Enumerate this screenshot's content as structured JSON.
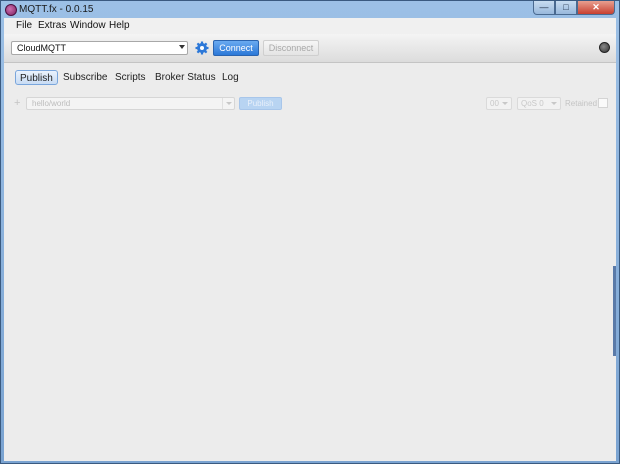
{
  "window": {
    "title": "MQTT.fx - 0.0.15",
    "controls": [
      "—",
      "□",
      "✕"
    ]
  },
  "menu": [
    "File",
    "Extras",
    "Window",
    "Help"
  ],
  "toolbar": {
    "connection_profile": "CloudMQTT",
    "connect_label": "Connect",
    "disconnect_label": "Disconnect",
    "colors": {
      "connect": "#2c78d8",
      "settings_icon": "#2c78d8"
    }
  },
  "tabs": [
    "Publish",
    "Subscribe",
    "Scripts",
    "Broker Status",
    "Log"
  ],
  "active_tab": "Publish",
  "publish": {
    "add_symbol": "+",
    "topic": "hello/world",
    "publish_label": "Publish",
    "qos_left": "00",
    "qos_right": "QoS 0",
    "retained_label": "Retained"
  }
}
